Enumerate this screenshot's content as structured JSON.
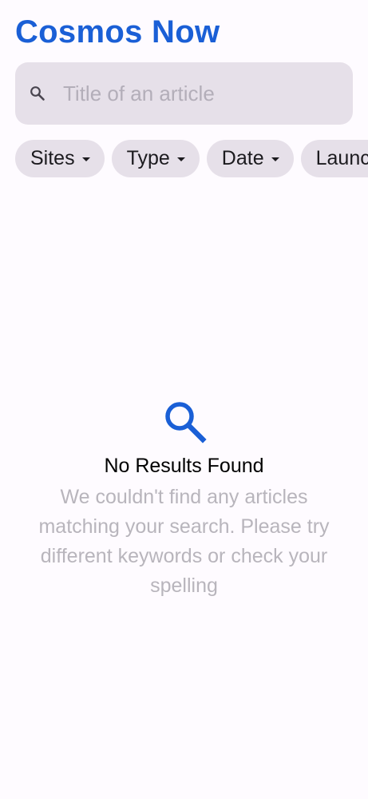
{
  "app": {
    "title": "Cosmos Now"
  },
  "search": {
    "placeholder": "Title of an article",
    "value": "",
    "icon": "search-icon"
  },
  "filters": [
    {
      "label": "Sites",
      "icon": "caret-down-icon"
    },
    {
      "label": "Type",
      "icon": "caret-down-icon"
    },
    {
      "label": "Date",
      "icon": "caret-down-icon"
    },
    {
      "label": "Launches",
      "icon": "caret-down-icon"
    }
  ],
  "empty_state": {
    "icon": "search-icon",
    "title": "No Results Found",
    "message": "We couldn't find any articles matching your search. Please try different keywords or check your spelling"
  },
  "colors": {
    "brand": "#1a5fd6",
    "surface": "#e6e0e9",
    "background": "#fefbff",
    "muted_text": "#b8b5bc"
  }
}
